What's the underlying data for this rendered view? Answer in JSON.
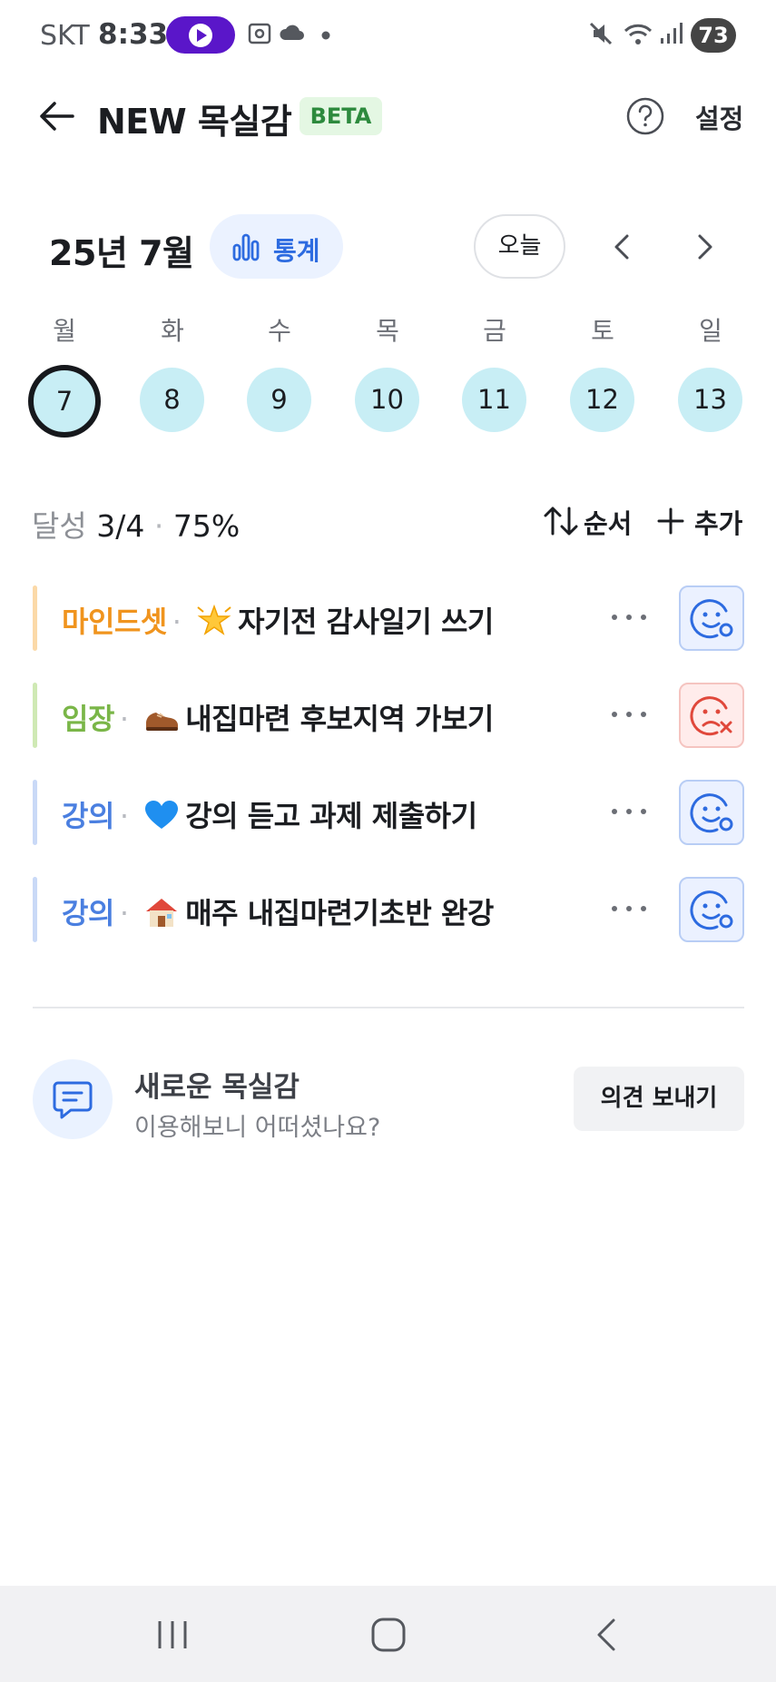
{
  "status_bar": {
    "carrier": "SKT",
    "time": "8:33",
    "battery": "73"
  },
  "header": {
    "title": "NEW 목실감",
    "badge": "BETA",
    "settings_label": "설정"
  },
  "calendar": {
    "month_label": "25년 7월",
    "stats_label": "통계",
    "today_label": "오늘",
    "weekdays": [
      "월",
      "화",
      "수",
      "목",
      "금",
      "토",
      "일"
    ],
    "days": [
      "7",
      "8",
      "9",
      "10",
      "11",
      "12",
      "13"
    ],
    "selected_day": "7"
  },
  "progress": {
    "prefix": "달성",
    "count": "3/4",
    "separator": "·",
    "percent": "75%",
    "order_label": "순서",
    "add_label": "추가"
  },
  "tasks": [
    {
      "category": "마인드셋",
      "emoji": "glowing-star",
      "text": "자기전 감사일기 쓰기",
      "status": "done",
      "color": "#f0941e",
      "bar_color": "#fbd9a8"
    },
    {
      "category": "임장",
      "emoji": "shoe",
      "text": "내집마련 후보지역 가보기",
      "status": "failed",
      "color": "#7ab648",
      "bar_color": "#cfe9b4"
    },
    {
      "category": "강의",
      "emoji": "blue-heart",
      "text": "강의 듣고 과제 제출하기",
      "status": "done",
      "color": "#4a7fe0",
      "bar_color": "#c9d9f7"
    },
    {
      "category": "강의",
      "emoji": "house",
      "text": "매주 내집마련기초반 완강",
      "status": "done",
      "color": "#4a7fe0",
      "bar_color": "#c9d9f7"
    }
  ],
  "feedback": {
    "title": "새로운 목실감",
    "subtitle": "이용해보니 어떠셨나요?",
    "button_label": "의견 보내기"
  },
  "colors": {
    "accent": "#2d6be0",
    "day_bg": "#c8eef5",
    "success_face": "#2d6be0",
    "fail_face": "#e0483b"
  }
}
